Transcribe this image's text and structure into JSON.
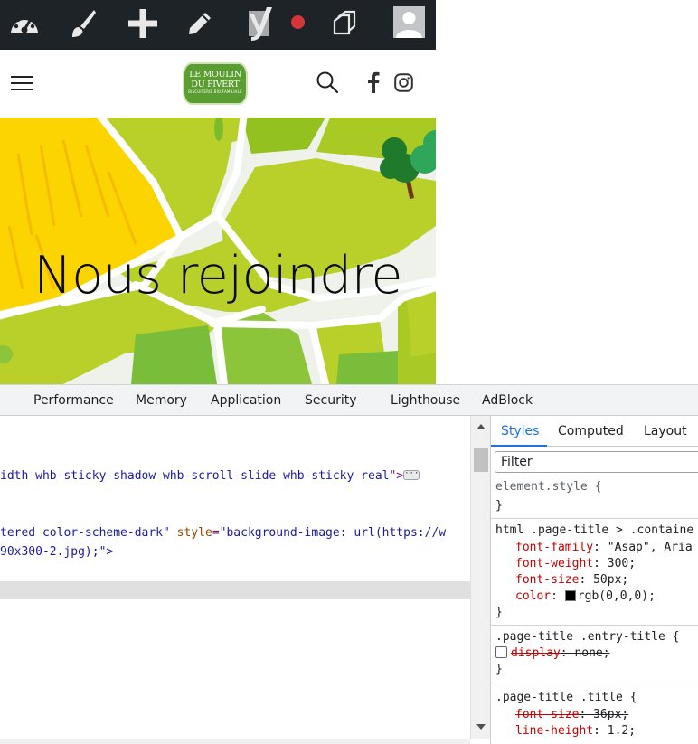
{
  "site": {
    "logo": {
      "line1": "LE MOULIN",
      "line2": "DU PIVERT",
      "line3": "BISCUITERIE BIO FAMILIALE"
    },
    "hero_title": "Nous rejoindre"
  },
  "admin_bar": {
    "icons": [
      "dashboard-icon",
      "paintbrush-icon",
      "plus-icon",
      "pencil-icon",
      "yoast-icon",
      "status-dot",
      "copy-icon",
      "avatar"
    ],
    "status_dot_color": "#d63638"
  },
  "devtools": {
    "tabs": [
      "Performance",
      "Memory",
      "Application",
      "Security",
      "Lighthouse",
      "AdBlock"
    ],
    "elements": {
      "line1": {
        "text": "idth whb-sticky-shadow whb-scroll-slide whb-sticky-real",
        "close": "\">"
      },
      "line2": {
        "pre": "tered color-scheme-dark\" ",
        "attr": "style",
        "eq": "=",
        "val": "\"background-image: url(https://w"
      },
      "line3": {
        "text": "90x300-2.jpg);\">"
      }
    },
    "styles_tabs": [
      "Styles",
      "Computed",
      "Layout"
    ],
    "filter_placeholder": "Filter",
    "rules": {
      "r1": {
        "selector": "element.style {",
        "close": "}"
      },
      "r2": {
        "selector": "html .page-title > .containe",
        "props": [
          {
            "name": "font-family",
            "value": "\"Asap\", Aria"
          },
          {
            "name": "font-weight",
            "value": "300;"
          },
          {
            "name": "font-size",
            "value": "50px;"
          },
          {
            "name": "color",
            "value": "rgb(0,0,0);"
          }
        ],
        "close": "}"
      },
      "r3": {
        "selector": ".page-title .entry-title {",
        "prop": "display",
        "value": "none;",
        "close": "}"
      },
      "r4": {
        "selector": ".page-title .title {",
        "props": [
          {
            "name": "font-size",
            "value": "36px;"
          },
          {
            "name": "line-height",
            "value": "1.2;"
          }
        ],
        "close": "}"
      }
    }
  }
}
